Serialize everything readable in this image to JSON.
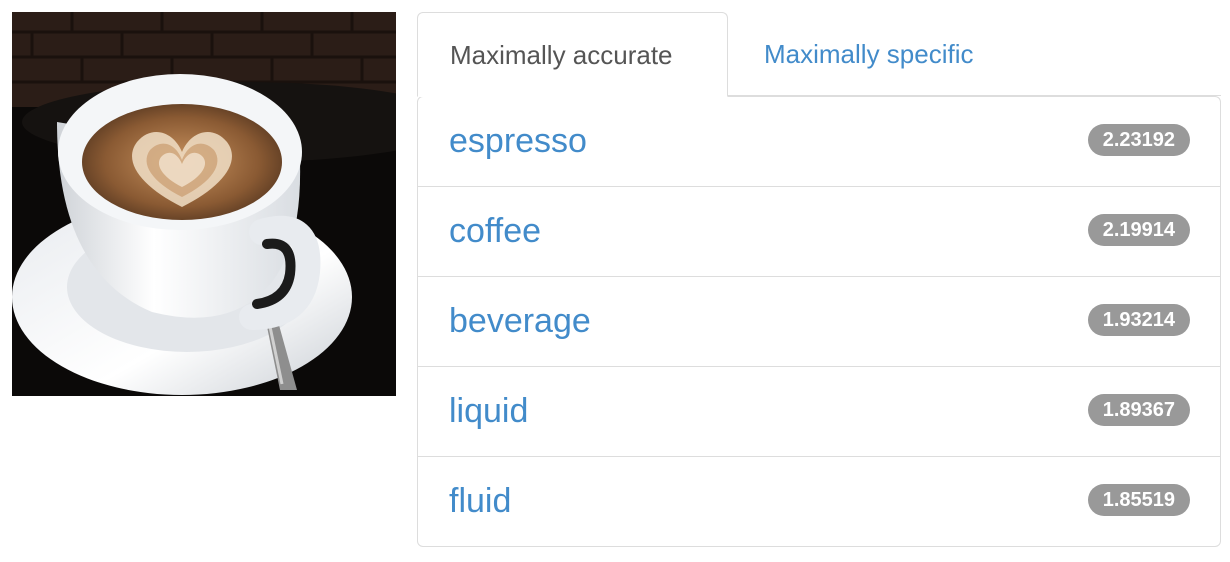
{
  "tabs": [
    {
      "label": "Maximally accurate",
      "active": true
    },
    {
      "label": "Maximally specific",
      "active": false
    }
  ],
  "results": [
    {
      "label": "espresso",
      "score": "2.23192"
    },
    {
      "label": "coffee",
      "score": "2.19914"
    },
    {
      "label": "beverage",
      "score": "1.93214"
    },
    {
      "label": "liquid",
      "score": "1.89367"
    },
    {
      "label": "fluid",
      "score": "1.85519"
    }
  ],
  "colors": {
    "link": "#428bca",
    "badge": "#999999",
    "border": "#dddddd",
    "active_tab_text": "#555555"
  }
}
